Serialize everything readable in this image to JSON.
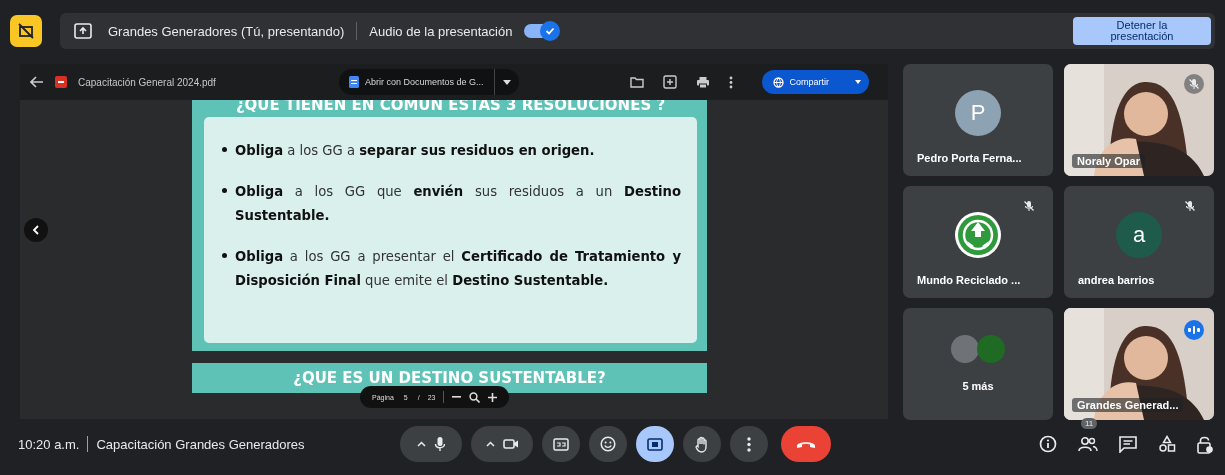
{
  "presenting_bar": {
    "title": "Grandes Generadores (Tú, presentando)",
    "audio_label": "Audio de la presentación",
    "audio_on": true,
    "stop_button": "Detener la presentación"
  },
  "viewer": {
    "file_name": "Capacitación General 2024.pdf",
    "open_with": "Abrir con Documentos de G...",
    "share_button": "Compartir"
  },
  "slide": {
    "heading": "¿QUE TIENEN EN COMUN ESTAS 3 RESOLUCIONES ?",
    "bullets": [
      "**Obliga** a los GG a **separar sus residuos en origen.**",
      "**Obliga** a los GG que **envién** sus residuos a un **Destino Sustentable.**",
      "**Obliga** a los GG a presentar el **Certificado de Tratamiento y Disposición Final** que emite el **Destino Sustentable.**"
    ],
    "next_heading": "¿QUE ES UN DESTINO SUSTENTABLE?"
  },
  "page_control": {
    "label": "Página",
    "current": "5",
    "separator": "/",
    "total": "23"
  },
  "participants": [
    {
      "kind": "avatar",
      "name": "Pedro Porta Ferna...",
      "initial": "P",
      "color": "#8da2b2",
      "muted": false,
      "speaking": false
    },
    {
      "kind": "video",
      "name": "Noraly Opar",
      "muted": true,
      "speaking": false
    },
    {
      "kind": "logo",
      "name": "Mundo Reciclado ...",
      "muted": true,
      "speaking": false
    },
    {
      "kind": "avatar",
      "name": "andrea barrios",
      "initial": "a",
      "color": "#1e5b4a",
      "muted": true,
      "speaking": false
    },
    {
      "kind": "more",
      "name": "5 más",
      "muted": false,
      "speaking": false
    },
    {
      "kind": "video",
      "name": "Grandes Generad...",
      "muted": false,
      "speaking": true
    }
  ],
  "bottom_bar": {
    "time": "10:20 a.m.",
    "meeting_title": "Capacitación Grandes Generadores",
    "people_count": "11"
  },
  "controls": [
    {
      "kind": "mic",
      "active": false
    },
    {
      "kind": "camera",
      "active": false
    },
    {
      "kind": "captions",
      "active": false
    },
    {
      "kind": "emoji",
      "active": false
    },
    {
      "kind": "present",
      "active": true
    },
    {
      "kind": "hand",
      "active": false
    },
    {
      "kind": "more",
      "active": false
    },
    {
      "kind": "hangup",
      "active": false
    }
  ]
}
